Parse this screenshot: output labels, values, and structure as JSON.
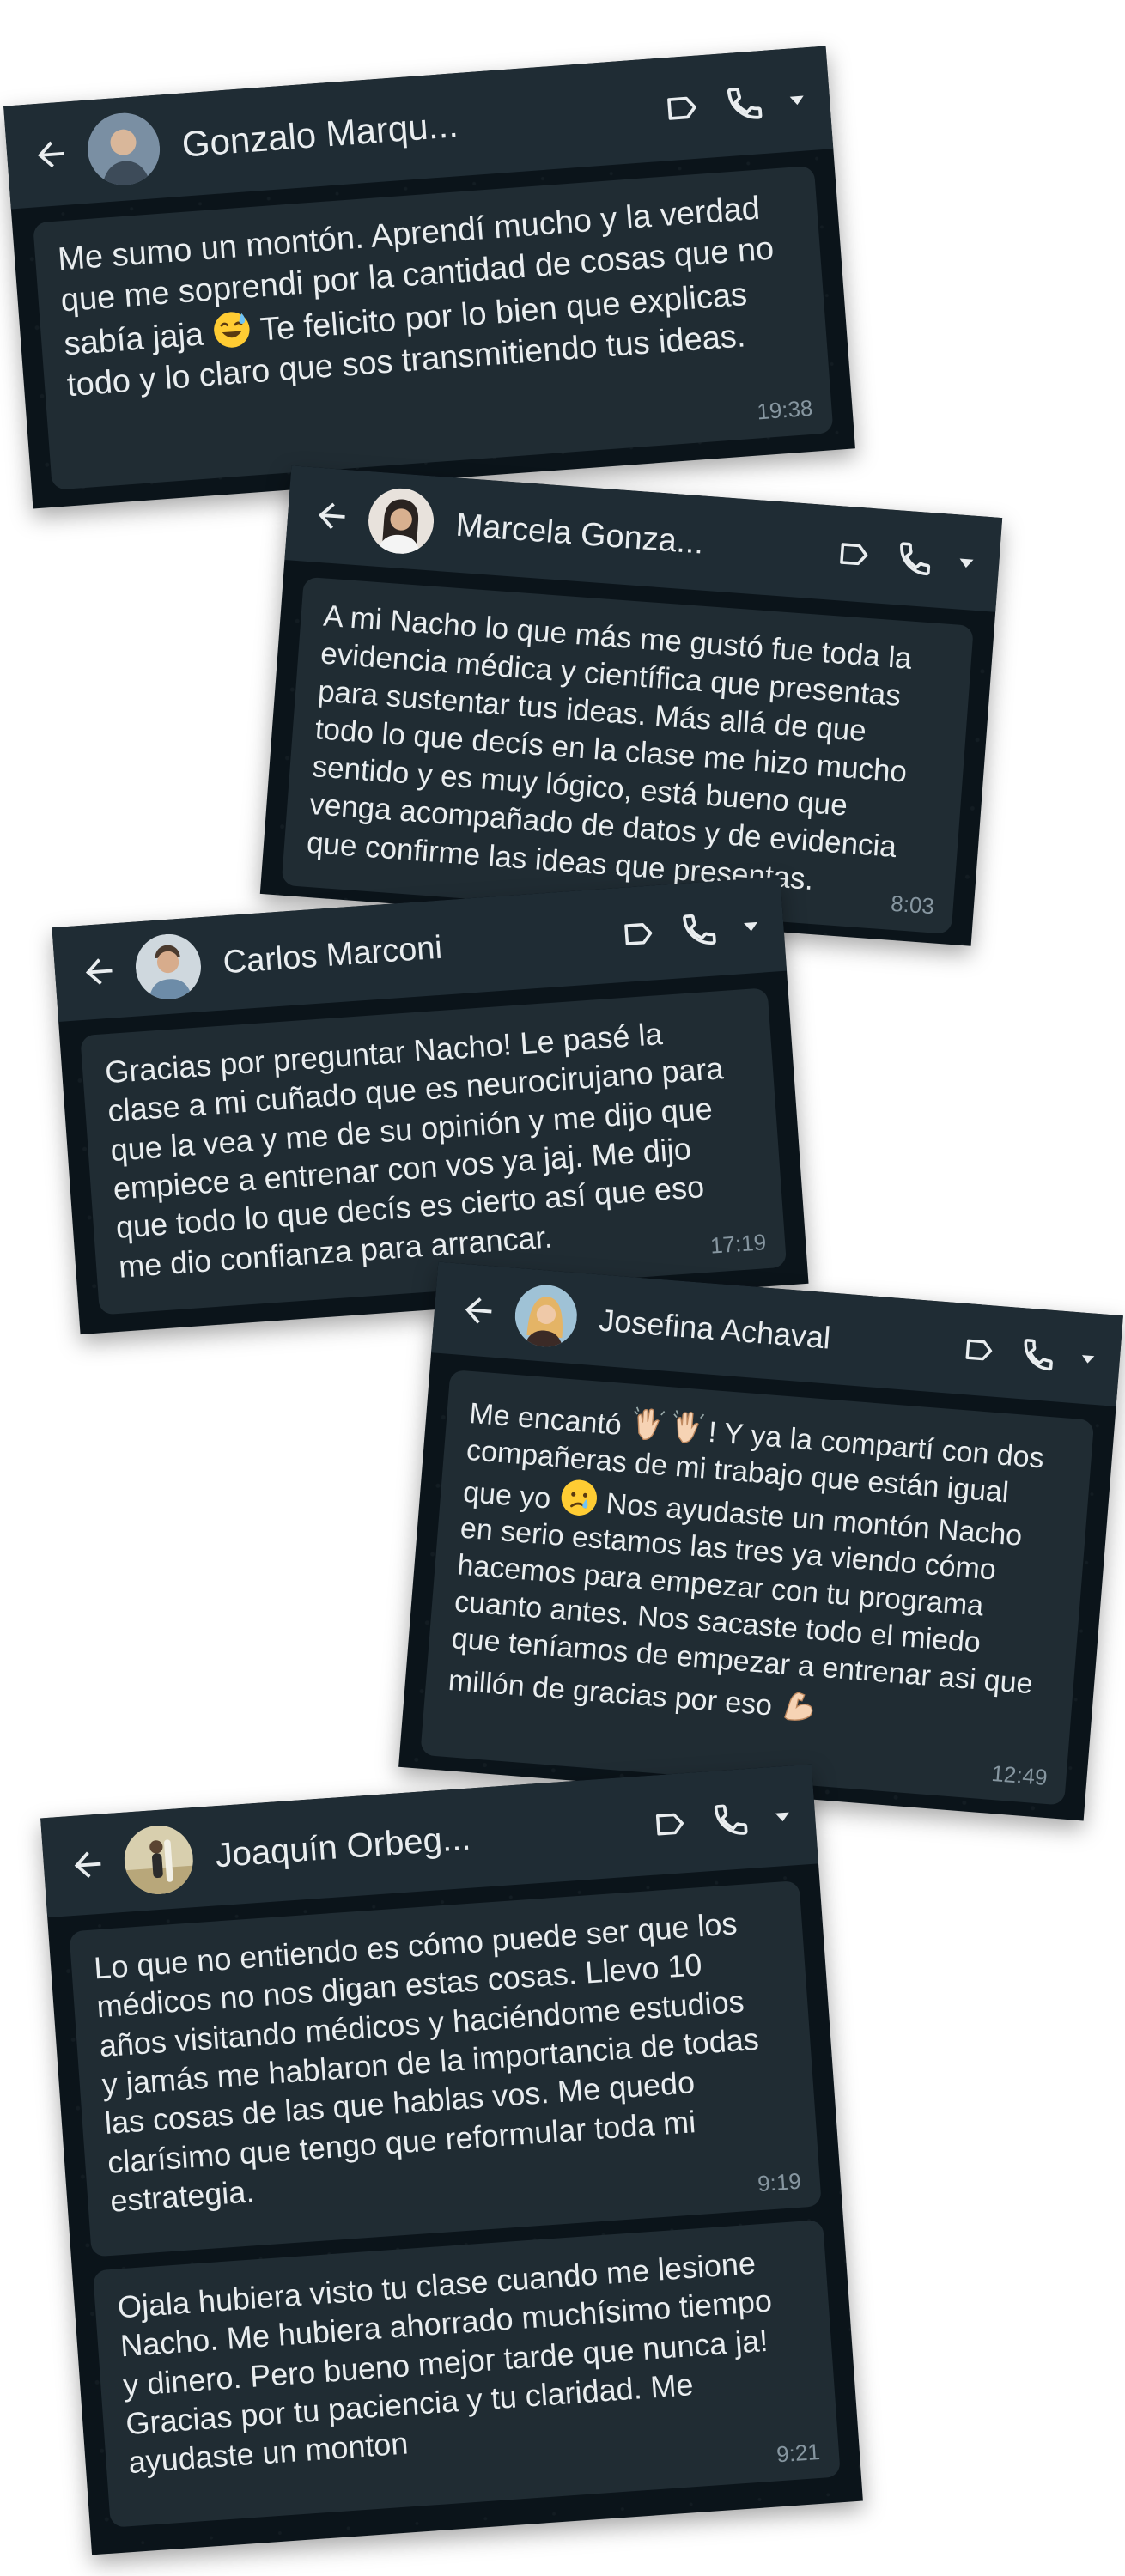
{
  "chats": [
    {
      "contact": "Gonzalo Marqu...",
      "messages": [
        {
          "time": "19:38",
          "parts": [
            {
              "t": "Me sumo un montón. Aprendí mucho y la verdad que me soprendi por la cantidad de cosas que no sabía jaja "
            },
            {
              "emoji": "sweat-smile-emoji"
            },
            {
              "t": " Te felicito por lo bien que explicas todo y lo claro que sos transmitiendo tus ideas."
            }
          ]
        }
      ]
    },
    {
      "contact": "Marcela Gonza...",
      "messages": [
        {
          "time": "8:03",
          "parts": [
            {
              "t": "A mi Nacho lo que más me gustó fue toda la evidencia médica y científica que presentas para sustentar tus ideas. Más allá de que todo lo que decís en la clase me hizo mucho sentido y es muy lógico, está bueno que venga acompañado de datos y de evidencia que confirme las ideas que presentas."
            }
          ]
        }
      ]
    },
    {
      "contact": "Carlos Marconi",
      "messages": [
        {
          "time": "17:19",
          "parts": [
            {
              "t": "Gracias por preguntar Nacho! Le pasé la clase a mi cuñado que es neurocirujano para que la vea y me de su opinión y me dijo que empiece a entrenar con vos ya jaj. Me dijo que todo lo que decís es cierto así que eso me dio confianza para arrancar."
            }
          ]
        }
      ]
    },
    {
      "contact": "Josefina Achaval",
      "messages": [
        {
          "time": "12:49",
          "parts": [
            {
              "t": "Me encantó "
            },
            {
              "emoji": "clapping-hands-emoji"
            },
            {
              "emoji": "clapping-hands-emoji"
            },
            {
              "t": "! Y ya la compartí con dos compañeras de mi trabajo que están igual que yo "
            },
            {
              "emoji": "crying-face-emoji"
            },
            {
              "t": " Nos ayudaste un montón Nacho en serio estamos las tres ya viendo cómo hacemos para empezar con tu programa cuanto antes. Nos sacaste todo el miedo que teníamos de empezar a entrenar asi que millón de gracias por eso "
            },
            {
              "emoji": "flexed-biceps-emoji"
            }
          ]
        }
      ]
    },
    {
      "contact": "Joaquín Orbeg...",
      "messages": [
        {
          "time": "9:19",
          "parts": [
            {
              "t": "Lo que no entiendo es cómo puede ser que los médicos no nos digan estas cosas. Llevo 10 años visitando médicos y haciéndome estudios y jamás me hablaron de la importancia de todas las cosas de las que hablas vos. Me quedo clarísimo que tengo que reformular toda mi estrategia."
            }
          ]
        },
        {
          "time": "9:21",
          "parts": [
            {
              "t": "Ojala hubiera visto tu clase cuando me lesione Nacho. Me hubiera ahorrado muchísimo tiempo y dinero. Pero bueno mejor tarde que nunca ja! Gracias por tu paciencia y tu claridad. Me ayudaste un monton"
            }
          ]
        }
      ]
    }
  ],
  "colors": {
    "chat_bg": "#0b141a",
    "header_bg": "#1f2c34",
    "bubble_bg": "#202c33",
    "text": "#e9edef",
    "time": "#8696a0"
  },
  "icons": {
    "back": "arrow-left-icon",
    "label": "label-tag-icon",
    "call": "phone-icon",
    "menu": "caret-down-icon"
  }
}
